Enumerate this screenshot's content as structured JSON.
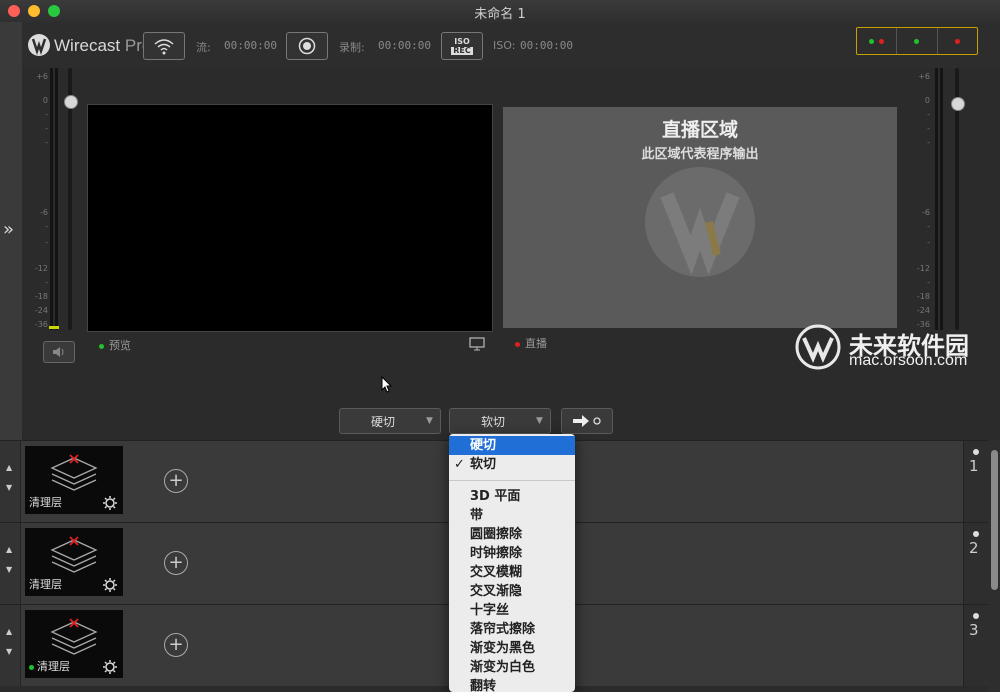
{
  "window": {
    "title": "未命名 1"
  },
  "app": {
    "logo_name": "Wirecast",
    "logo_edition": "Pro"
  },
  "topbar": {
    "stream_label": "流:",
    "stream_time": "00:00:00",
    "record_label": "录制:",
    "record_time": "00:00:00",
    "iso_label": "ISO:",
    "iso_time": "00:00:00",
    "iso_icon_top": "ISO",
    "iso_icon_bottom": "REC"
  },
  "meters": {
    "left_scale": [
      "+6",
      "0",
      "-",
      "-",
      "-",
      "-6",
      "-",
      "-",
      "-12",
      "-",
      "-18",
      "-24",
      "-36"
    ],
    "right_scale": [
      "+6",
      "0",
      "-",
      "-",
      "-",
      "-6",
      "-",
      "-",
      "-12",
      "-",
      "-18",
      "-24",
      "-36"
    ]
  },
  "preview": {
    "label": "预览",
    "status_color": "#22c22b"
  },
  "live": {
    "heading": "直播区域",
    "subheading": "此区域代表程序输出",
    "label": "直播",
    "status_color": "#e02020"
  },
  "transitions": {
    "left_selected": "硬切",
    "right_selected": "软切"
  },
  "layers": [
    {
      "name": "清理层",
      "number": "1",
      "active": false
    },
    {
      "name": "清理层",
      "number": "2",
      "active": false
    },
    {
      "name": "清理层",
      "number": "3",
      "active": true
    }
  ],
  "dropdown": {
    "items_top": [
      {
        "label": "硬切",
        "highlighted": true,
        "checked": false
      },
      {
        "label": "软切",
        "highlighted": false,
        "checked": true
      }
    ],
    "items": [
      "3D 平面",
      "带",
      "圆圈擦除",
      "时钟擦除",
      "交叉模糊",
      "交叉渐隐",
      "十字丝",
      "落帘式擦除",
      "渐变为黑色",
      "渐变为白色",
      "翻转"
    ]
  },
  "watermark": {
    "title": "未来软件园",
    "url": "mac.orsoon.com"
  },
  "colors": {
    "accent": "#1f6fd6",
    "live_dot": "#e02020",
    "preview_dot": "#22c22b",
    "status_box_border": "#c8a000"
  }
}
